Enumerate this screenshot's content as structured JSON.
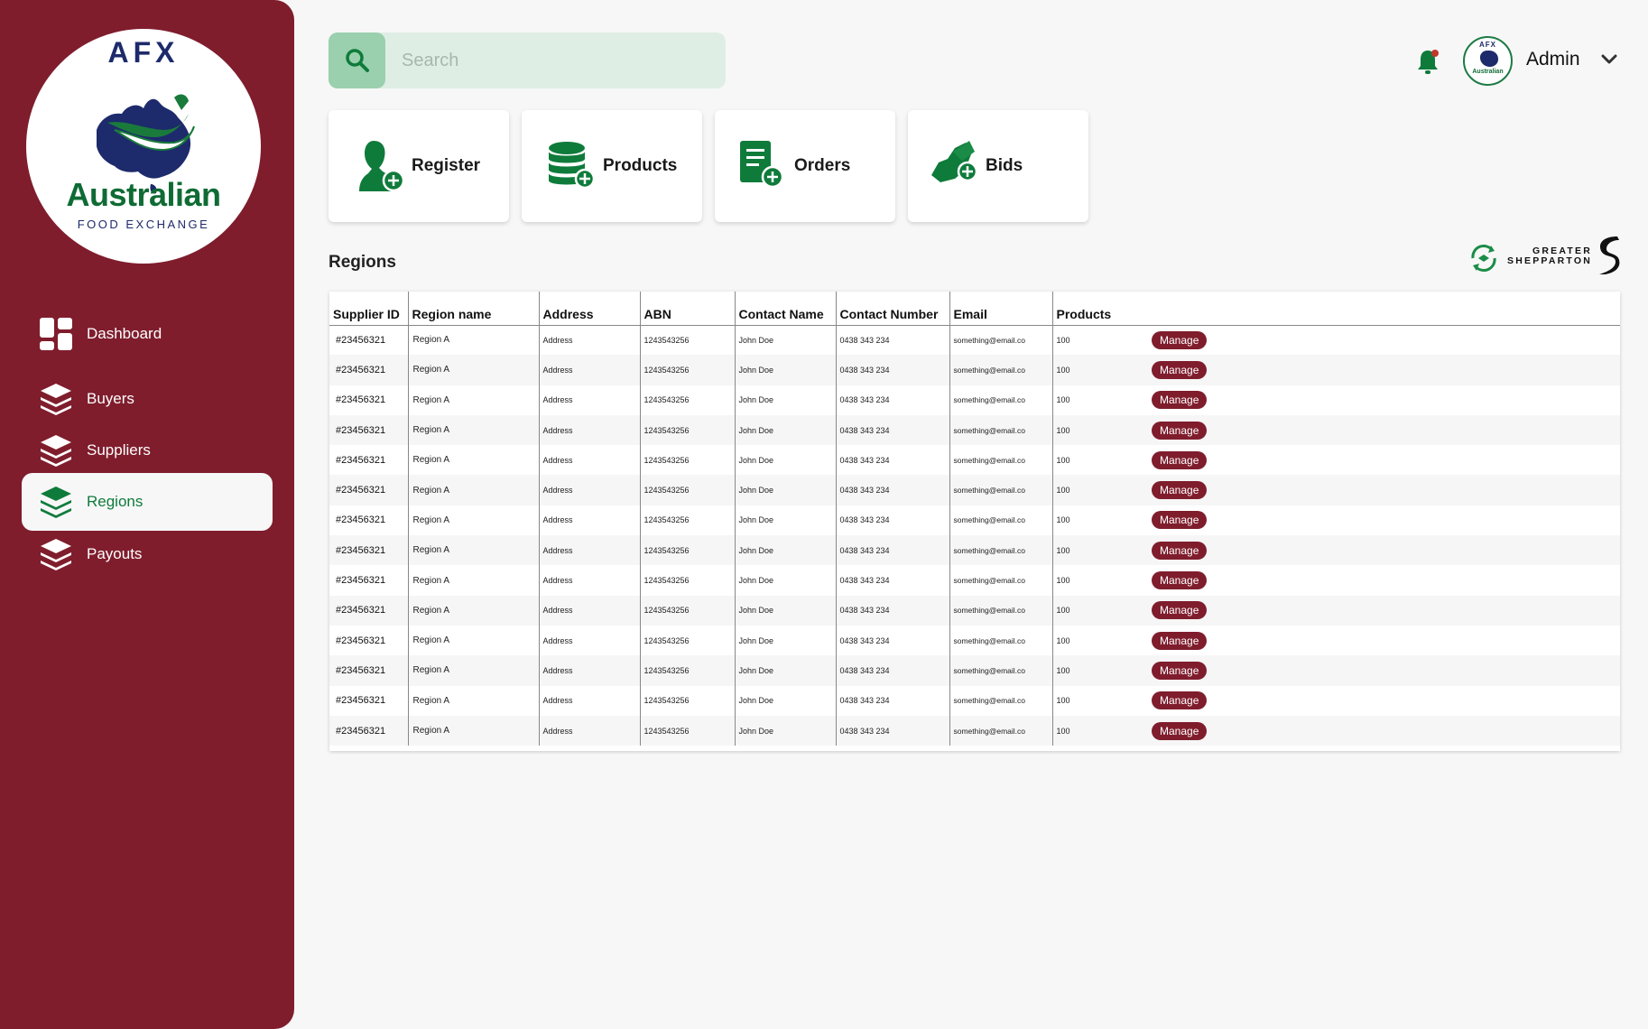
{
  "logo": {
    "top_text": "AFX",
    "main_text": "Australian",
    "sub_text": "FOOD EXCHANGE"
  },
  "sidebar": {
    "items": [
      {
        "label": "Dashboard",
        "icon": "dashboard-icon",
        "active": false
      },
      {
        "label": "Buyers",
        "icon": "layers-icon",
        "active": false
      },
      {
        "label": "Suppliers",
        "icon": "layers-icon",
        "active": false
      },
      {
        "label": "Regions",
        "icon": "layers-icon",
        "active": true
      },
      {
        "label": "Payouts",
        "icon": "layers-icon",
        "active": false
      }
    ]
  },
  "search": {
    "placeholder": "Search",
    "icon": "search-icon"
  },
  "header": {
    "user_name": "Admin",
    "avatar_top": "AFX",
    "avatar_bottom": "Australian",
    "notification_icon": "bell-icon"
  },
  "actions": [
    {
      "label": "Register",
      "icon": "register-user-icon"
    },
    {
      "label": "Products",
      "icon": "products-database-icon"
    },
    {
      "label": "Orders",
      "icon": "orders-document-icon"
    },
    {
      "label": "Bids",
      "icon": "bids-hand-icon"
    }
  ],
  "section": {
    "title": "Regions"
  },
  "partner": {
    "line1": "GREATER",
    "line2": "SHEPPARTON"
  },
  "table": {
    "columns": [
      "Supplier ID",
      "Region name",
      "Address",
      "ABN",
      "Contact Name",
      "Contact Number",
      "Email",
      "Products"
    ],
    "action_label": "Manage",
    "rows": [
      [
        "#23456321",
        "Region A",
        "Address",
        "1243543256",
        "John Doe",
        "0438 343 234",
        "something@email.co",
        "100"
      ],
      [
        "#23456321",
        "Region A",
        "Address",
        "1243543256",
        "John Doe",
        "0438 343 234",
        "something@email.co",
        "100"
      ],
      [
        "#23456321",
        "Region A",
        "Address",
        "1243543256",
        "John Doe",
        "0438 343 234",
        "something@email.co",
        "100"
      ],
      [
        "#23456321",
        "Region A",
        "Address",
        "1243543256",
        "John Doe",
        "0438 343 234",
        "something@email.co",
        "100"
      ],
      [
        "#23456321",
        "Region A",
        "Address",
        "1243543256",
        "John Doe",
        "0438 343 234",
        "something@email.co",
        "100"
      ],
      [
        "#23456321",
        "Region A",
        "Address",
        "1243543256",
        "John Doe",
        "0438 343 234",
        "something@email.co",
        "100"
      ],
      [
        "#23456321",
        "Region A",
        "Address",
        "1243543256",
        "John Doe",
        "0438 343 234",
        "something@email.co",
        "100"
      ],
      [
        "#23456321",
        "Region A",
        "Address",
        "1243543256",
        "John Doe",
        "0438 343 234",
        "something@email.co",
        "100"
      ],
      [
        "#23456321",
        "Region A",
        "Address",
        "1243543256",
        "John Doe",
        "0438 343 234",
        "something@email.co",
        "100"
      ],
      [
        "#23456321",
        "Region A",
        "Address",
        "1243543256",
        "John Doe",
        "0438 343 234",
        "something@email.co",
        "100"
      ],
      [
        "#23456321",
        "Region A",
        "Address",
        "1243543256",
        "John Doe",
        "0438 343 234",
        "something@email.co",
        "100"
      ],
      [
        "#23456321",
        "Region A",
        "Address",
        "1243543256",
        "John Doe",
        "0438 343 234",
        "something@email.co",
        "100"
      ],
      [
        "#23456321",
        "Region A",
        "Address",
        "1243543256",
        "John Doe",
        "0438 343 234",
        "something@email.co",
        "100"
      ],
      [
        "#23456321",
        "Region A",
        "Address",
        "1243543256",
        "John Doe",
        "0438 343 234",
        "something@email.co",
        "100"
      ]
    ]
  },
  "colors": {
    "sidebar": "#7f1d2d",
    "accent_green": "#0f7b3b",
    "search_bg": "#dfeee4",
    "manage_button": "#7f1d2d"
  }
}
